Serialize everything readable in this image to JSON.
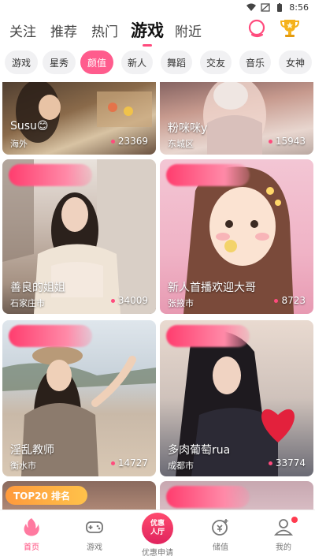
{
  "status_bar": {
    "time": "8:56"
  },
  "top_tabs": [
    {
      "label": "关注",
      "active": false
    },
    {
      "label": "推荐",
      "active": false
    },
    {
      "label": "热门",
      "active": false
    },
    {
      "label": "游戏",
      "active": true
    },
    {
      "label": "附近",
      "active": false
    }
  ],
  "top_actions": {
    "search_icon": "search-icon",
    "trophy_icon": "trophy-icon"
  },
  "categories": [
    {
      "label": "游戏",
      "active": false
    },
    {
      "label": "星秀",
      "active": false
    },
    {
      "label": "颜值",
      "active": true
    },
    {
      "label": "新人",
      "active": false
    },
    {
      "label": "舞蹈",
      "active": false
    },
    {
      "label": "交友",
      "active": false
    },
    {
      "label": "音乐",
      "active": false
    },
    {
      "label": "女神",
      "active": false
    }
  ],
  "cards": [
    {
      "title": "Susu😊",
      "city": "海外",
      "views": "23369"
    },
    {
      "title": "粉咪咪y",
      "city": "东城区",
      "views": "15943"
    },
    {
      "title": "善良的姐姐",
      "city": "石家庄市",
      "views": "34009"
    },
    {
      "title": "新人首播欢迎大哥",
      "city": "张掖市",
      "views": "8723"
    },
    {
      "title": "淫乱教师",
      "city": "衡水市",
      "views": "14727"
    },
    {
      "title": "多肉葡萄rua",
      "city": "成都市",
      "views": "33774"
    }
  ],
  "rank_badge": {
    "label": "TOP20 排名"
  },
  "bottom_nav": {
    "home": "首页",
    "game": "游戏",
    "center_line1": "优惠",
    "center_line2": "人厅",
    "center": "优惠申请",
    "value": "储值",
    "mine": "我的"
  },
  "colors": {
    "accent": "#ff4b7d",
    "chip_bg": "#f1f1f3"
  }
}
